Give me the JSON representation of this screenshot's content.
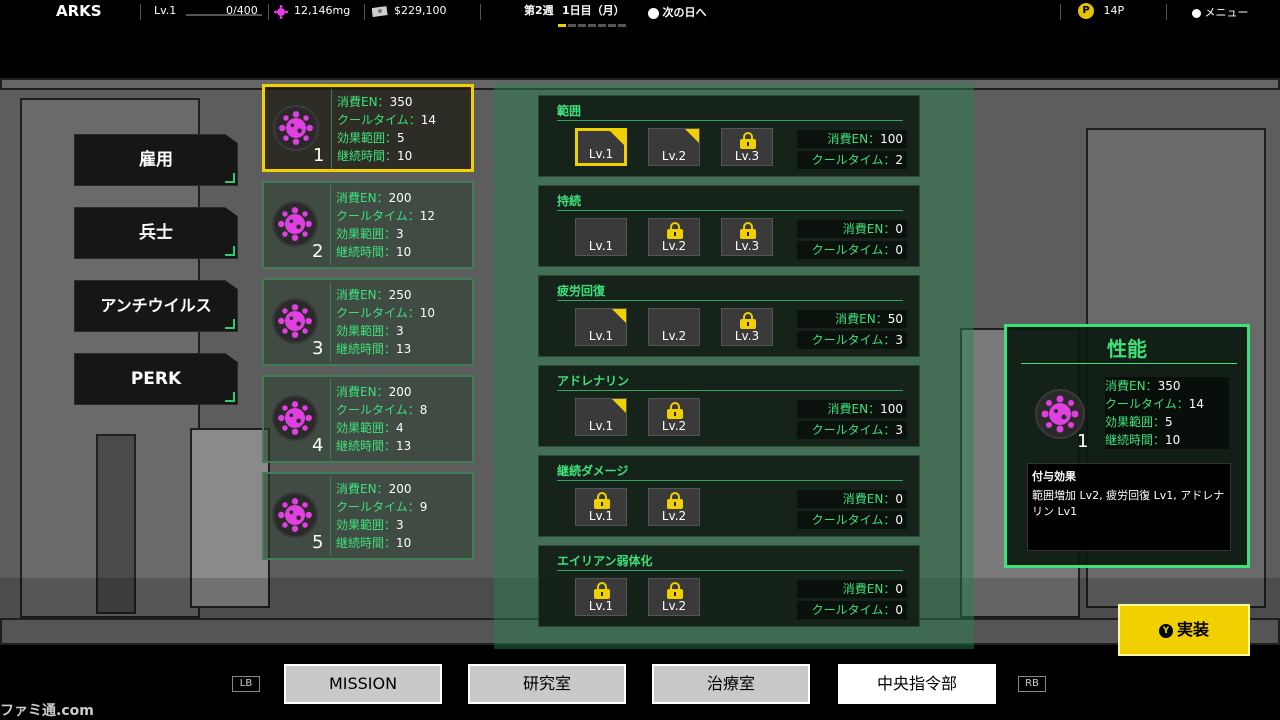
{
  "topbar": {
    "game_name": "ARKS",
    "level": "Lv.1",
    "xp": "0/400",
    "xp_fraction": 0.0,
    "resource": "12,146mg",
    "money": "$229,100",
    "week": "第2週",
    "day": "1日目（月）",
    "next_day": "次の日へ",
    "points": "14P",
    "points_icon": "P",
    "menu": "メニュー"
  },
  "nav": {
    "items": [
      {
        "label": "雇用"
      },
      {
        "label": "兵士"
      },
      {
        "label": "アンチウイルス"
      },
      {
        "label": "PERK"
      }
    ]
  },
  "cards": [
    {
      "num": "1",
      "en": "350",
      "cooldown": "14",
      "range": "5",
      "duration": "10"
    },
    {
      "num": "2",
      "en": "200",
      "cooldown": "12",
      "range": "3",
      "duration": "10"
    },
    {
      "num": "3",
      "en": "250",
      "cooldown": "10",
      "range": "3",
      "duration": "13"
    },
    {
      "num": "4",
      "en": "200",
      "cooldown": "8",
      "range": "4",
      "duration": "13"
    },
    {
      "num": "5",
      "en": "200",
      "cooldown": "9",
      "range": "3",
      "duration": "10"
    }
  ],
  "labels": {
    "en": "消費EN：",
    "cooldown": "クールタイム：",
    "range": "効果範囲：",
    "duration": "継続時間："
  },
  "sections": [
    {
      "title": "範囲",
      "lv1": "Lv.1",
      "lv2": "Lv.2",
      "lv3": "Lv.3",
      "en": "100",
      "cooldown": "2"
    },
    {
      "title": "持続",
      "lv1": "Lv.1",
      "lv2": "Lv.2",
      "lv3": "Lv.3",
      "en": "0",
      "cooldown": "0"
    },
    {
      "title": "疲労回復",
      "lv1": "Lv.1",
      "lv2": "Lv.2",
      "lv3": "Lv.3",
      "en": "50",
      "cooldown": "3"
    },
    {
      "title": "アドレナリン",
      "lv1": "Lv.1",
      "lv2": "Lv.2",
      "en": "100",
      "cooldown": "3"
    },
    {
      "title": "継続ダメージ",
      "lv1": "Lv.1",
      "lv2": "Lv.2",
      "en": "0",
      "cooldown": "0"
    },
    {
      "title": "エイリアン弱体化",
      "lv1": "Lv.1",
      "lv2": "Lv.2",
      "en": "0",
      "cooldown": "0"
    }
  ],
  "perf": {
    "title": "性能",
    "num": "1",
    "en": "350",
    "cooldown": "14",
    "range": "5",
    "duration": "10",
    "effect_title": "付与効果",
    "effect_text": "範囲増加 Lv2, 疲労回復 Lv1, アドレナリン Lv1"
  },
  "apply": {
    "label": "実装",
    "button_glyph": "Y"
  },
  "bottom": {
    "lb": "LB",
    "rb": "RB",
    "tabs": [
      {
        "label": "MISSION"
      },
      {
        "label": "研究室"
      },
      {
        "label": "治療室"
      },
      {
        "label": "中央指令部"
      }
    ]
  },
  "watermark": "ファミ通.com",
  "colors": {
    "accent_green": "#3ee07a",
    "select_yellow": "#f0d000",
    "virus_magenta": "#e040e0"
  }
}
